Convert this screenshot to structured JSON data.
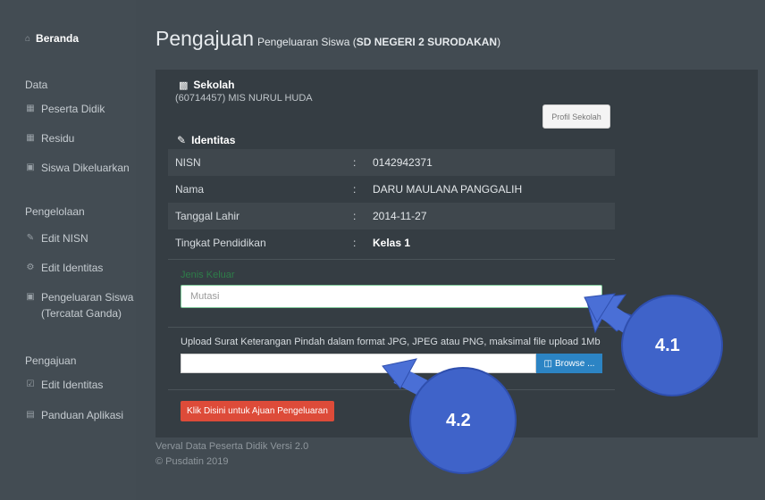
{
  "sidebar": {
    "home": "Beranda",
    "sections": [
      {
        "title": "Data",
        "items": [
          "Peserta Didik",
          "Residu",
          "Siswa Dikeluarkan"
        ]
      },
      {
        "title": "Pengelolaan",
        "items": [
          "Edit NISN",
          "Edit Identitas",
          "Pengeluaran Siswa",
          "(Tercatat Ganda)"
        ]
      },
      {
        "title": "Pengajuan",
        "items": [
          "Edit Identitas",
          "Panduan Aplikasi"
        ]
      }
    ]
  },
  "page": {
    "title": "Pengajuan",
    "subtitle_prefix": "Pengeluaran Siswa (",
    "school": "SD NEGERI 2 SURODAKAN",
    "subtitle_suffix": ")"
  },
  "sekolah": {
    "heading": "Sekolah",
    "value": "(60714457) MIS NURUL HUDA",
    "profile_button": "Profil Sekolah"
  },
  "identitas": {
    "heading": "Identitas",
    "rows": [
      {
        "label": "NISN",
        "colon": ":",
        "value": "0142942371"
      },
      {
        "label": "Nama",
        "colon": ":",
        "value": "DARU MAULANA PANGGALIH"
      },
      {
        "label": "Tanggal Lahir",
        "colon": ":",
        "value": "2014-11-27"
      },
      {
        "label": "Tingkat Pendidikan",
        "colon": ":",
        "value": "Kelas 1"
      }
    ]
  },
  "form": {
    "jenis_keluar_label": "Jenis Keluar",
    "jenis_keluar_value": "Mutasi",
    "upload_label": "Upload Surat Keterangan Pindah dalam format JPG, JPEG atau PNG, maksimal file upload 1Mb",
    "browse_label": "Browse ...",
    "submit_label": "Klik Disini untuk Ajuan Pengeluaran"
  },
  "footer": {
    "line1": "Verval Data Peserta Didik Versi 2.0",
    "line2": "© Pusdatin 2019"
  },
  "annotations": {
    "a1": "4.1",
    "a2": "4.2"
  },
  "colors": {
    "background": "#424b52",
    "panel": "#353d43",
    "browse": "#2c84c4",
    "submit": "#dd4b39",
    "annotation_circle": "#3f63c9"
  }
}
